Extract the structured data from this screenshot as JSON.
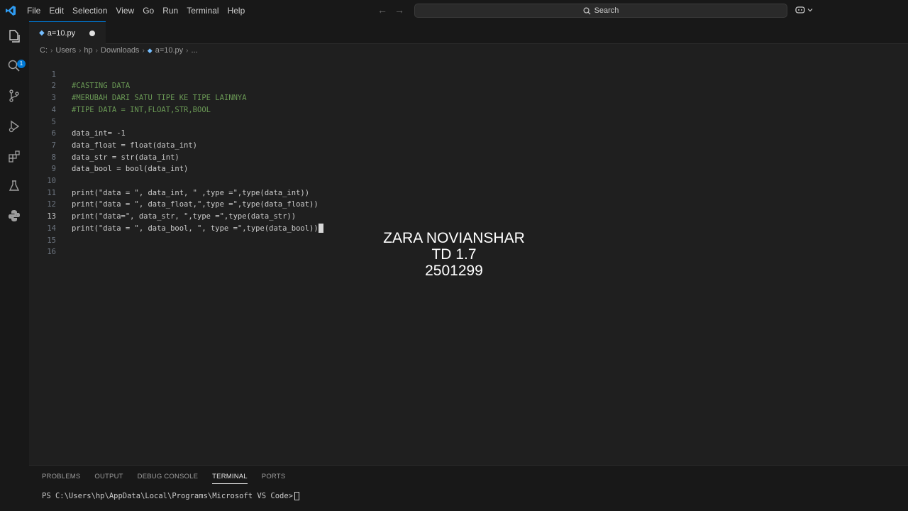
{
  "titlebar": {
    "menu": [
      "File",
      "Edit",
      "Selection",
      "View",
      "Go",
      "Run",
      "Terminal",
      "Help"
    ],
    "search_label": "Search"
  },
  "activity": {
    "badge_count": "1"
  },
  "tab": {
    "name": "a=10.py"
  },
  "breadcrumb": [
    "C:",
    "Users",
    "hp",
    "Downloads",
    "a=10.py",
    "..."
  ],
  "editor": {
    "active_line": 13,
    "lines": [
      {
        "n": "1",
        "text": "#CASTING DATA"
      },
      {
        "n": "2",
        "text": "#MERUBAH DARI SATU TIPE KE TIPE LAINNYA"
      },
      {
        "n": "3",
        "text": "#TIPE DATA = INT,FLOAT,STR,BOOL"
      },
      {
        "n": "4",
        "text": ""
      },
      {
        "n": "5",
        "text": "data_int= -1"
      },
      {
        "n": "6",
        "text": "data_float = float(data_int)"
      },
      {
        "n": "7",
        "text": "data_str = str(data_int)"
      },
      {
        "n": "8",
        "text": "data_bool = bool(data_int)"
      },
      {
        "n": "9",
        "text": ""
      },
      {
        "n": "10",
        "text": "print(\"data = \", data_int, \" ,type =\",type(data_int))"
      },
      {
        "n": "11",
        "text": "print(\"data = \", data_float,\",type =\",type(data_float))"
      },
      {
        "n": "12",
        "text": "print(\"data=\", data_str, \",type =\",type(data_str))"
      },
      {
        "n": "13",
        "text": "print(\"data = \", data_bool, \", type =\",type(data_bool))"
      },
      {
        "n": "14",
        "text": ""
      },
      {
        "n": "15",
        "text": ""
      },
      {
        "n": "16",
        "text": ""
      }
    ]
  },
  "overlay": {
    "line1": "ZARA NOVIANSHAR",
    "line2": "TD 1.7",
    "line3": "2501299"
  },
  "panel": {
    "tabs": [
      "PROBLEMS",
      "OUTPUT",
      "DEBUG CONSOLE",
      "TERMINAL",
      "PORTS"
    ],
    "active_tab": "TERMINAL",
    "terminal_prompt": "PS C:\\Users\\hp\\AppData\\Local\\Programs\\Microsoft VS Code>"
  },
  "colors": {
    "accent": "#0078d4",
    "comment": "#6a9955",
    "string": "#ce9178",
    "function": "#dcdcaa",
    "number": "#b5cea8"
  }
}
